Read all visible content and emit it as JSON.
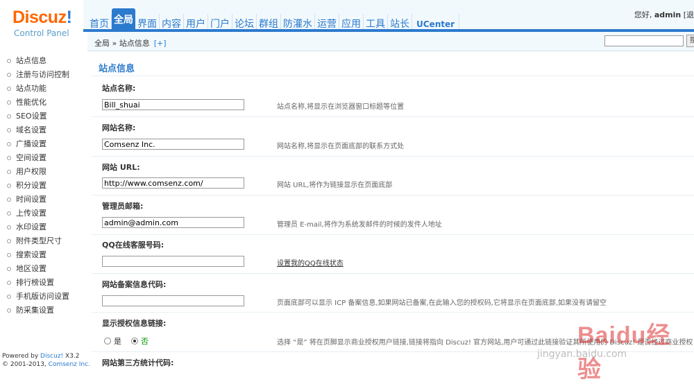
{
  "logo": {
    "brand": "Discuz",
    "brand_excl": "!",
    "subtitle": "Control Panel"
  },
  "topnav": {
    "items": [
      "首页",
      "全局",
      "界面",
      "内容",
      "用户",
      "门户",
      "论坛",
      "群组",
      "防灌水",
      "运营",
      "应用",
      "工具",
      "站长",
      "UCenter"
    ],
    "active": "全局"
  },
  "greeting": {
    "prefix": "您好,",
    "user": "admin",
    "suffix": "[退"
  },
  "breadcrumb": {
    "path": "全局 » 站点信息",
    "add": "[+]",
    "search_button": "搜"
  },
  "sidebar": {
    "items": [
      "站点信息",
      "注册与访问控制",
      "站点功能",
      "性能优化",
      "SEO设置",
      "域名设置",
      "广播设置",
      "空间设置",
      "用户权限",
      "积分设置",
      "时间设置",
      "上传设置",
      "水印设置",
      "附件类型尺寸",
      "搜索设置",
      "地区设置",
      "排行榜设置",
      "手机版访问设置",
      "防采集设置"
    ]
  },
  "footer": {
    "powered_prefix": "Powered by",
    "powered_brand": "Discuz!",
    "version": "X3.2",
    "copyright": "© 2001-2013,",
    "company": "Comsenz Inc."
  },
  "main": {
    "title": "站点信息",
    "fields": [
      {
        "label": "站点名称:",
        "value": "Bill_shuai",
        "tip": "站点名称,将显示在浏览器窗口标题等位置"
      },
      {
        "label": "网站名称:",
        "value": "Comsenz Inc.",
        "tip": "网站名称,将显示在页面底部的联系方式处"
      },
      {
        "label": "网站 URL:",
        "value": "http://www.comsenz.com/",
        "tip": "网站 URL,将作为链接显示在页面底部"
      },
      {
        "label": "管理员邮箱:",
        "value": "admin@admin.com",
        "tip": "管理员 E-mail,将作为系统发邮件的时候的发件人地址"
      },
      {
        "label": "QQ在线客服号码:",
        "value": "",
        "tip": "设置我的QQ在线状态"
      },
      {
        "label": "网站备案信息代码:",
        "value": "",
        "tip": "页面底部可以显示 ICP 备案信息,如果网站已备案,在此输入您的授权码,它将显示在页面底部,如果没有请留空"
      }
    ],
    "license_link": {
      "label": "显示授权信息链接:",
      "options": [
        "是",
        "否"
      ],
      "selected": "否",
      "tip": "选择 “是” 将在页脚显示商业授权用户链接,链接将指向 Discuz! 官方网站,用户可通过此链接验证其所使用的 Discuz! 是否经过商业授权"
    },
    "stats_label": "网站第三方统计代码:"
  },
  "watermark": {
    "text": "Baidu经验",
    "sub": "jingyan.baidu.com"
  }
}
